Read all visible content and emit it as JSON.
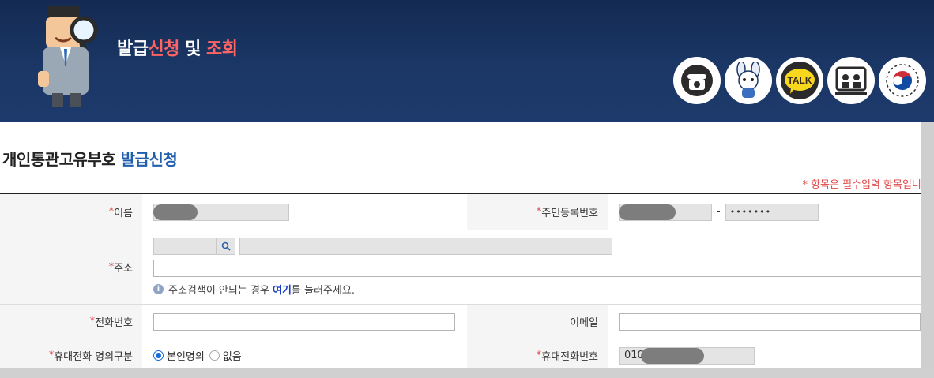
{
  "banner": {
    "title_part1": "발급",
    "title_part2": "신청",
    "title_part3": " 및 ",
    "title_part4": "조회",
    "icons": [
      {
        "name": "phone-icon"
      },
      {
        "name": "mascot-bunny-icon"
      },
      {
        "name": "kakao-talk-icon"
      },
      {
        "name": "consultation-icon"
      },
      {
        "name": "government-emblem-icon"
      }
    ],
    "talk_label": "TALK"
  },
  "page": {
    "title_main": "개인통관고유부호 ",
    "title_accent": "발급신청",
    "required_note": "* 항목은 필수입력 항목입니다."
  },
  "form": {
    "name_label": "이름",
    "rrn_label": "주민등록번호",
    "rrn_dash": "-",
    "rrn_back_masked": "•••••••",
    "address_label": "주소",
    "address_help_prefix": "주소검색이 안되는 경우 ",
    "address_help_link": "여기",
    "address_help_suffix": "를 눌러주세요.",
    "phone_label": "전화번호",
    "email_label": "이메일",
    "mobile_owner_label": "휴대전화 명의구분",
    "mobile_owner_options": [
      "본인명의",
      "없음"
    ],
    "mobile_owner_selected": "본인명의",
    "mobile_label": "휴대전화번호",
    "mobile_prefix": "010",
    "required_mark": "*"
  },
  "colors": {
    "banner_bg": "#1b3766",
    "accent_red": "#ff6464",
    "accent_blue": "#1f5fae",
    "required_red": "#e04848"
  }
}
